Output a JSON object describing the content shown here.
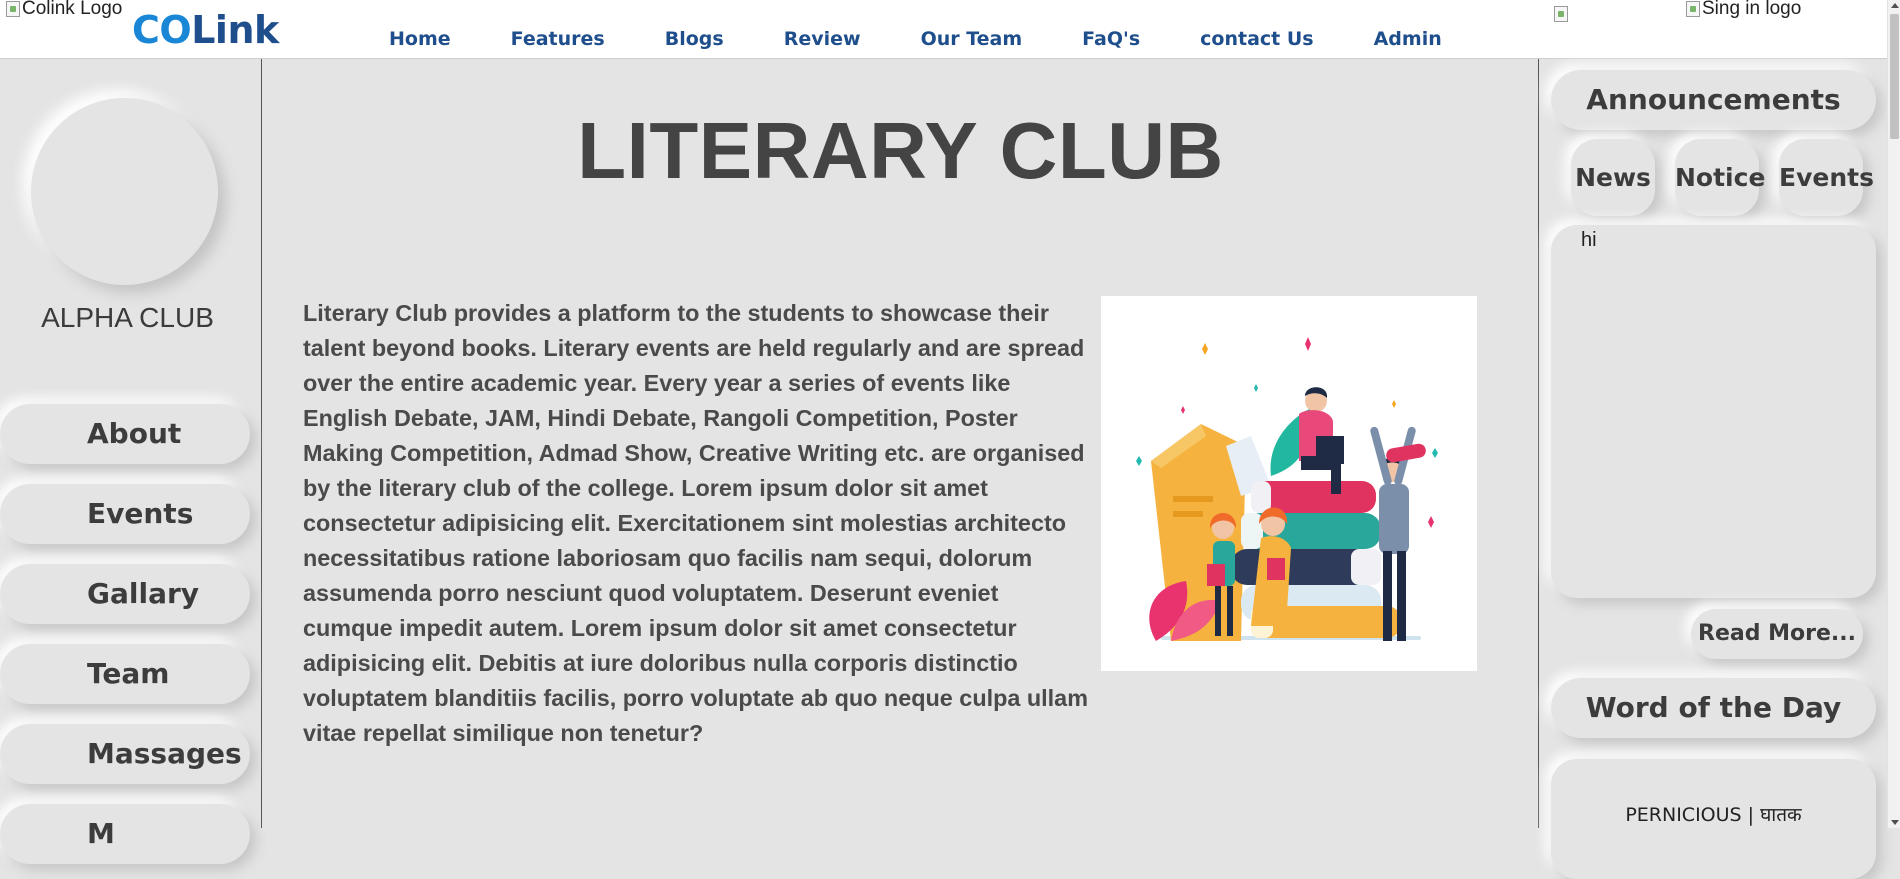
{
  "header": {
    "logo_alt": "Colink Logo",
    "brand_co": "CO",
    "brand_link": "Link",
    "nav": [
      "Home",
      "Features",
      "Blogs",
      "Review",
      "Our Team",
      "FaQ's",
      "contact Us",
      "Admin"
    ],
    "signin_alt": "Sing in logo"
  },
  "sidebar": {
    "club_name": "ALPHA CLUB",
    "menu": [
      "About",
      "Events",
      "Gallary",
      "Team",
      "Massages",
      "M"
    ]
  },
  "main": {
    "title": "LITERARY CLUB",
    "description": "Literary Club provides a platform to the students to showcase their talent beyond books. Literary events are held regularly and are spread over the entire academic year. Every year a series of events like English Debate, JAM, Hindi Debate, Rangoli Competition, Poster Making Competition, Admad Show, Creative Writing etc. are organised by the literary club of the college. Lorem ipsum dolor sit amet consectetur adipisicing elit. Exercitationem sint molestias architecto necessitatibus ratione laboriosam quo facilis nam sequi, dolorum assumenda porro nesciunt quod voluptatem. Deserunt eveniet cumque impedit autem. Lorem ipsum dolor sit amet consectetur adipisicing elit. Debitis at iure doloribus nulla corporis distinctio voluptatem blanditiis facilis, porro voluptate ab quo neque culpa ullam vitae repellat similique non tenetur?"
  },
  "right": {
    "announcements_title": "Announcements",
    "tabs": [
      "News",
      "Notice",
      "Events"
    ],
    "announcement_text": "hi",
    "read_more": "Read More...",
    "word_title": "Word of the Day",
    "word": "PERNICIOUS | घातक"
  },
  "colors": {
    "brand_co": "#1a86d6",
    "brand_link": "#1f4e8c",
    "nav_text": "#1f4e8c",
    "background": "#e4e4e4"
  }
}
